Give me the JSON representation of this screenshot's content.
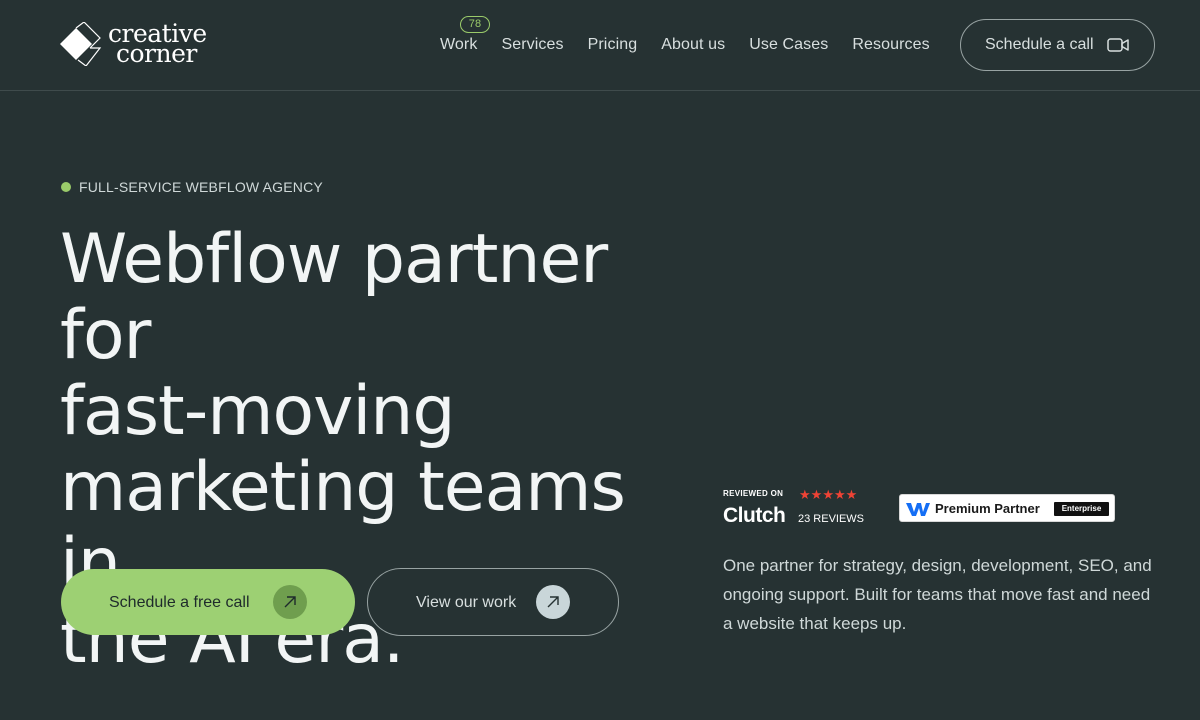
{
  "logo": {
    "line1": "creative",
    "line2": "corner"
  },
  "nav": {
    "items": [
      {
        "label": "Work",
        "badge": "78"
      },
      {
        "label": "Services"
      },
      {
        "label": "Pricing"
      },
      {
        "label": "About us"
      },
      {
        "label": "Use Cases"
      },
      {
        "label": "Resources"
      }
    ],
    "cta_label": "Schedule a call"
  },
  "hero": {
    "eyebrow": "FULL-SERVICE WEBFLOW AGENCY",
    "headline_line1": "Webflow partner for",
    "headline_line2": "fast-moving",
    "headline_line3": "marketing teams in",
    "headline_line4": "the AI era.",
    "primary_cta": "Schedule a free call",
    "secondary_cta": "View our work",
    "description": "One partner for strategy, design, development, SEO, and ongoing support. Built for teams that move fast and need a website that keeps up."
  },
  "clutch": {
    "reviewed_on": "REVIEWED ON",
    "logo_text": "Clutch",
    "reviews": "23 REVIEWS",
    "rating_stars": 5
  },
  "webflow_badge": {
    "text": "Premium Partner",
    "tag": "Enterprise"
  },
  "colors": {
    "background": "#263233",
    "accent_green": "#9dd073",
    "clutch_red": "#ef4335",
    "webflow_blue": "#146ef5"
  },
  "icons": {
    "header_cta": "video-camera-icon",
    "primary_cta": "arrow-up-right-icon",
    "secondary_cta": "arrow-up-right-icon",
    "logo": "diamond-logo-icon"
  }
}
